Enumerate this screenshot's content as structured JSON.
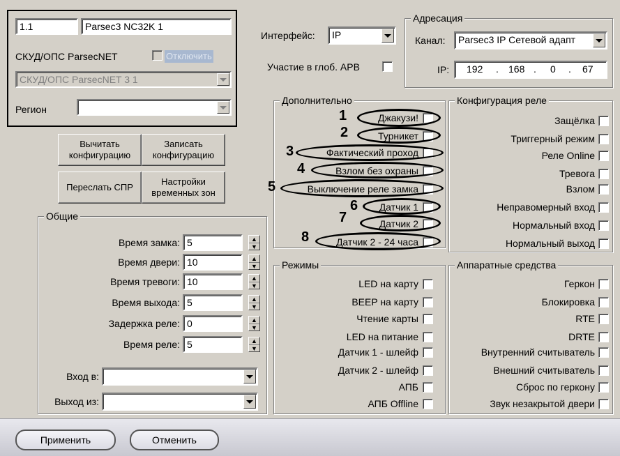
{
  "top_left": {
    "id_field": "1.1",
    "name_field": "Parsec3 NC32K 1",
    "parent_label": "СКУД/ОПС ParsecNET",
    "disable_label": "Отключить",
    "parent_combo": "СКУД/ОПС ParsecNET 3 1",
    "region_label": "Регион",
    "region_value": ""
  },
  "actions": {
    "read_config": "Вычитать конфигурацию",
    "write_config": "Записать конфигурацию",
    "send_spr": "Переслать СПР",
    "time_zones": "Настройки временных зон"
  },
  "interface": {
    "label": "Интерфейс:",
    "value": "IP",
    "arv_label": "Участие в глоб. APB"
  },
  "addressing": {
    "title": "Адресация",
    "channel_label": "Канал:",
    "channel_value": "Parsec3 IP Сетевой адапт",
    "ip_label": "IP:",
    "ip": [
      "192",
      "168",
      "0",
      "67"
    ]
  },
  "general": {
    "title": "Общие",
    "fields": [
      {
        "label": "Время замка:",
        "value": "5"
      },
      {
        "label": "Время двери:",
        "value": "10"
      },
      {
        "label": "Время тревоги:",
        "value": "10"
      },
      {
        "label": "Время выхода:",
        "value": "5"
      },
      {
        "label": "Задержка реле:",
        "value": "0"
      },
      {
        "label": "Время реле:",
        "value": "5"
      }
    ],
    "entry_label": "Вход в:",
    "exit_label": "Выход из:"
  },
  "additional": {
    "title": "Дополнительно",
    "items": [
      "Джакузи!",
      "Турникет",
      "Фактический проход",
      "Взлом без охраны",
      "Выключение реле замка",
      "Датчик 1",
      "Датчик 2",
      "Датчик 2 - 24 часа"
    ],
    "markers": [
      "1",
      "2",
      "3",
      "4",
      "5",
      "6",
      "7",
      "8"
    ]
  },
  "relay": {
    "title": "Конфигурация реле",
    "items": [
      "Защёлка",
      "Триггерный режим",
      "Реле Online",
      "Тревога",
      "Взлом",
      "Неправомерный вход",
      "Нормальный вход",
      "Нормальный выход"
    ]
  },
  "modes": {
    "title": "Режимы",
    "items": [
      "LED на карту",
      "BEEP на карту",
      "Чтение карты",
      "LED на питание",
      "Датчик 1 - шлейф",
      "Датчик 2 - шлейф",
      "АПБ",
      "АПБ Offline"
    ]
  },
  "hardware": {
    "title": "Аппаратные средства",
    "items": [
      "Геркон",
      "Блокировка",
      "RTE",
      "DRTE",
      "Внутренний считыватель",
      "Внешний считыватель",
      "Сброс по геркону",
      "Звук незакрытой двери"
    ]
  },
  "footer": {
    "apply": "Применить",
    "cancel": "Отменить"
  }
}
